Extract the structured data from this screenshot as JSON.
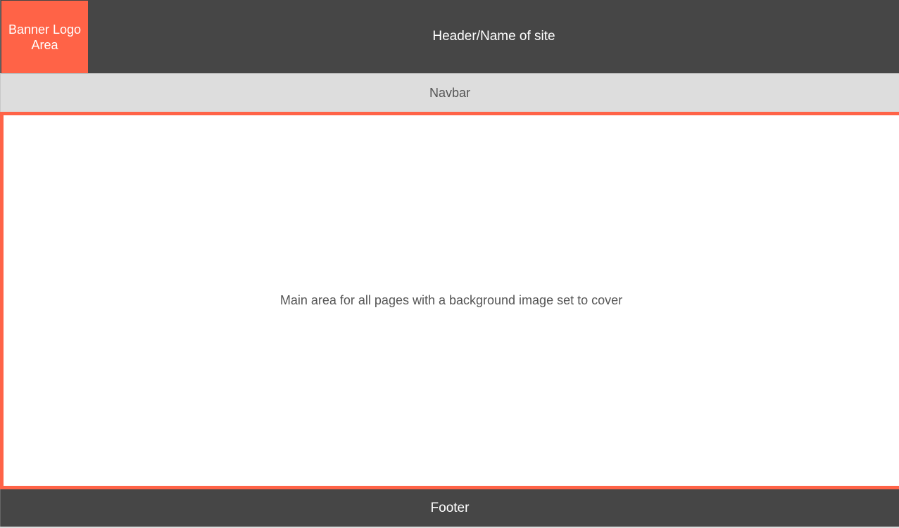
{
  "header": {
    "logo_label": "Banner Logo Area",
    "site_title": "Header/Name of site"
  },
  "navbar": {
    "label": "Navbar"
  },
  "main": {
    "text": "Main area for all pages with a background image set to cover"
  },
  "footer": {
    "label": "Footer"
  },
  "colors": {
    "accent": "#ff6347",
    "header_bg": "#464646",
    "navbar_bg": "#dddddd",
    "main_bg": "#ffffff"
  }
}
